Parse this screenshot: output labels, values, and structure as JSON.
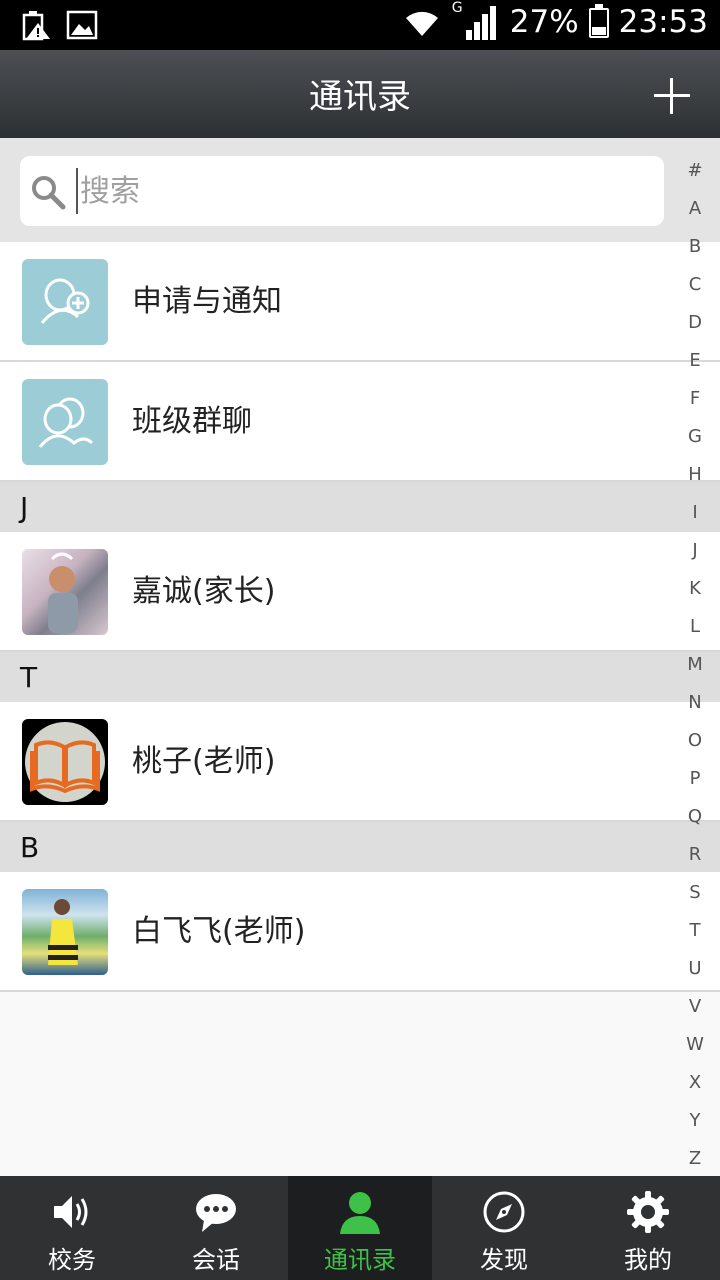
{
  "status_bar": {
    "battery": "27%",
    "time": "23:53",
    "network": "G"
  },
  "header": {
    "title": "通讯录"
  },
  "search": {
    "placeholder": "搜索"
  },
  "contacts": {
    "fixed": [
      {
        "label": "申请与通知",
        "icon": "person-add-icon"
      },
      {
        "label": "班级群聊",
        "icon": "group-icon"
      }
    ],
    "sections": [
      {
        "letter": "J",
        "items": [
          {
            "name": "嘉诚(家长)",
            "avatar": "photo"
          }
        ]
      },
      {
        "letter": "T",
        "items": [
          {
            "name": "桃子(老师)",
            "avatar": "book-icon"
          }
        ]
      },
      {
        "letter": "B",
        "items": [
          {
            "name": "白飞飞(老师)",
            "avatar": "photo"
          }
        ]
      }
    ]
  },
  "index_letters": [
    "#",
    "A",
    "B",
    "C",
    "D",
    "E",
    "F",
    "G",
    "H",
    "I",
    "J",
    "K",
    "L",
    "M",
    "N",
    "O",
    "P",
    "Q",
    "R",
    "S",
    "T",
    "U",
    "V",
    "W",
    "X",
    "Y",
    "Z"
  ],
  "bottom_nav": {
    "tabs": [
      {
        "label": "校务",
        "icon": "speaker-icon",
        "active": false
      },
      {
        "label": "会话",
        "icon": "chat-bubble-icon",
        "active": false
      },
      {
        "label": "通讯录",
        "icon": "person-icon",
        "active": true
      },
      {
        "label": "发现",
        "icon": "compass-icon",
        "active": false
      },
      {
        "label": "我的",
        "icon": "gear-icon",
        "active": false
      }
    ]
  },
  "colors": {
    "accent": "#3ec148",
    "header_bg": "#3a3d40",
    "tile_teal": "#9ccdd6"
  }
}
